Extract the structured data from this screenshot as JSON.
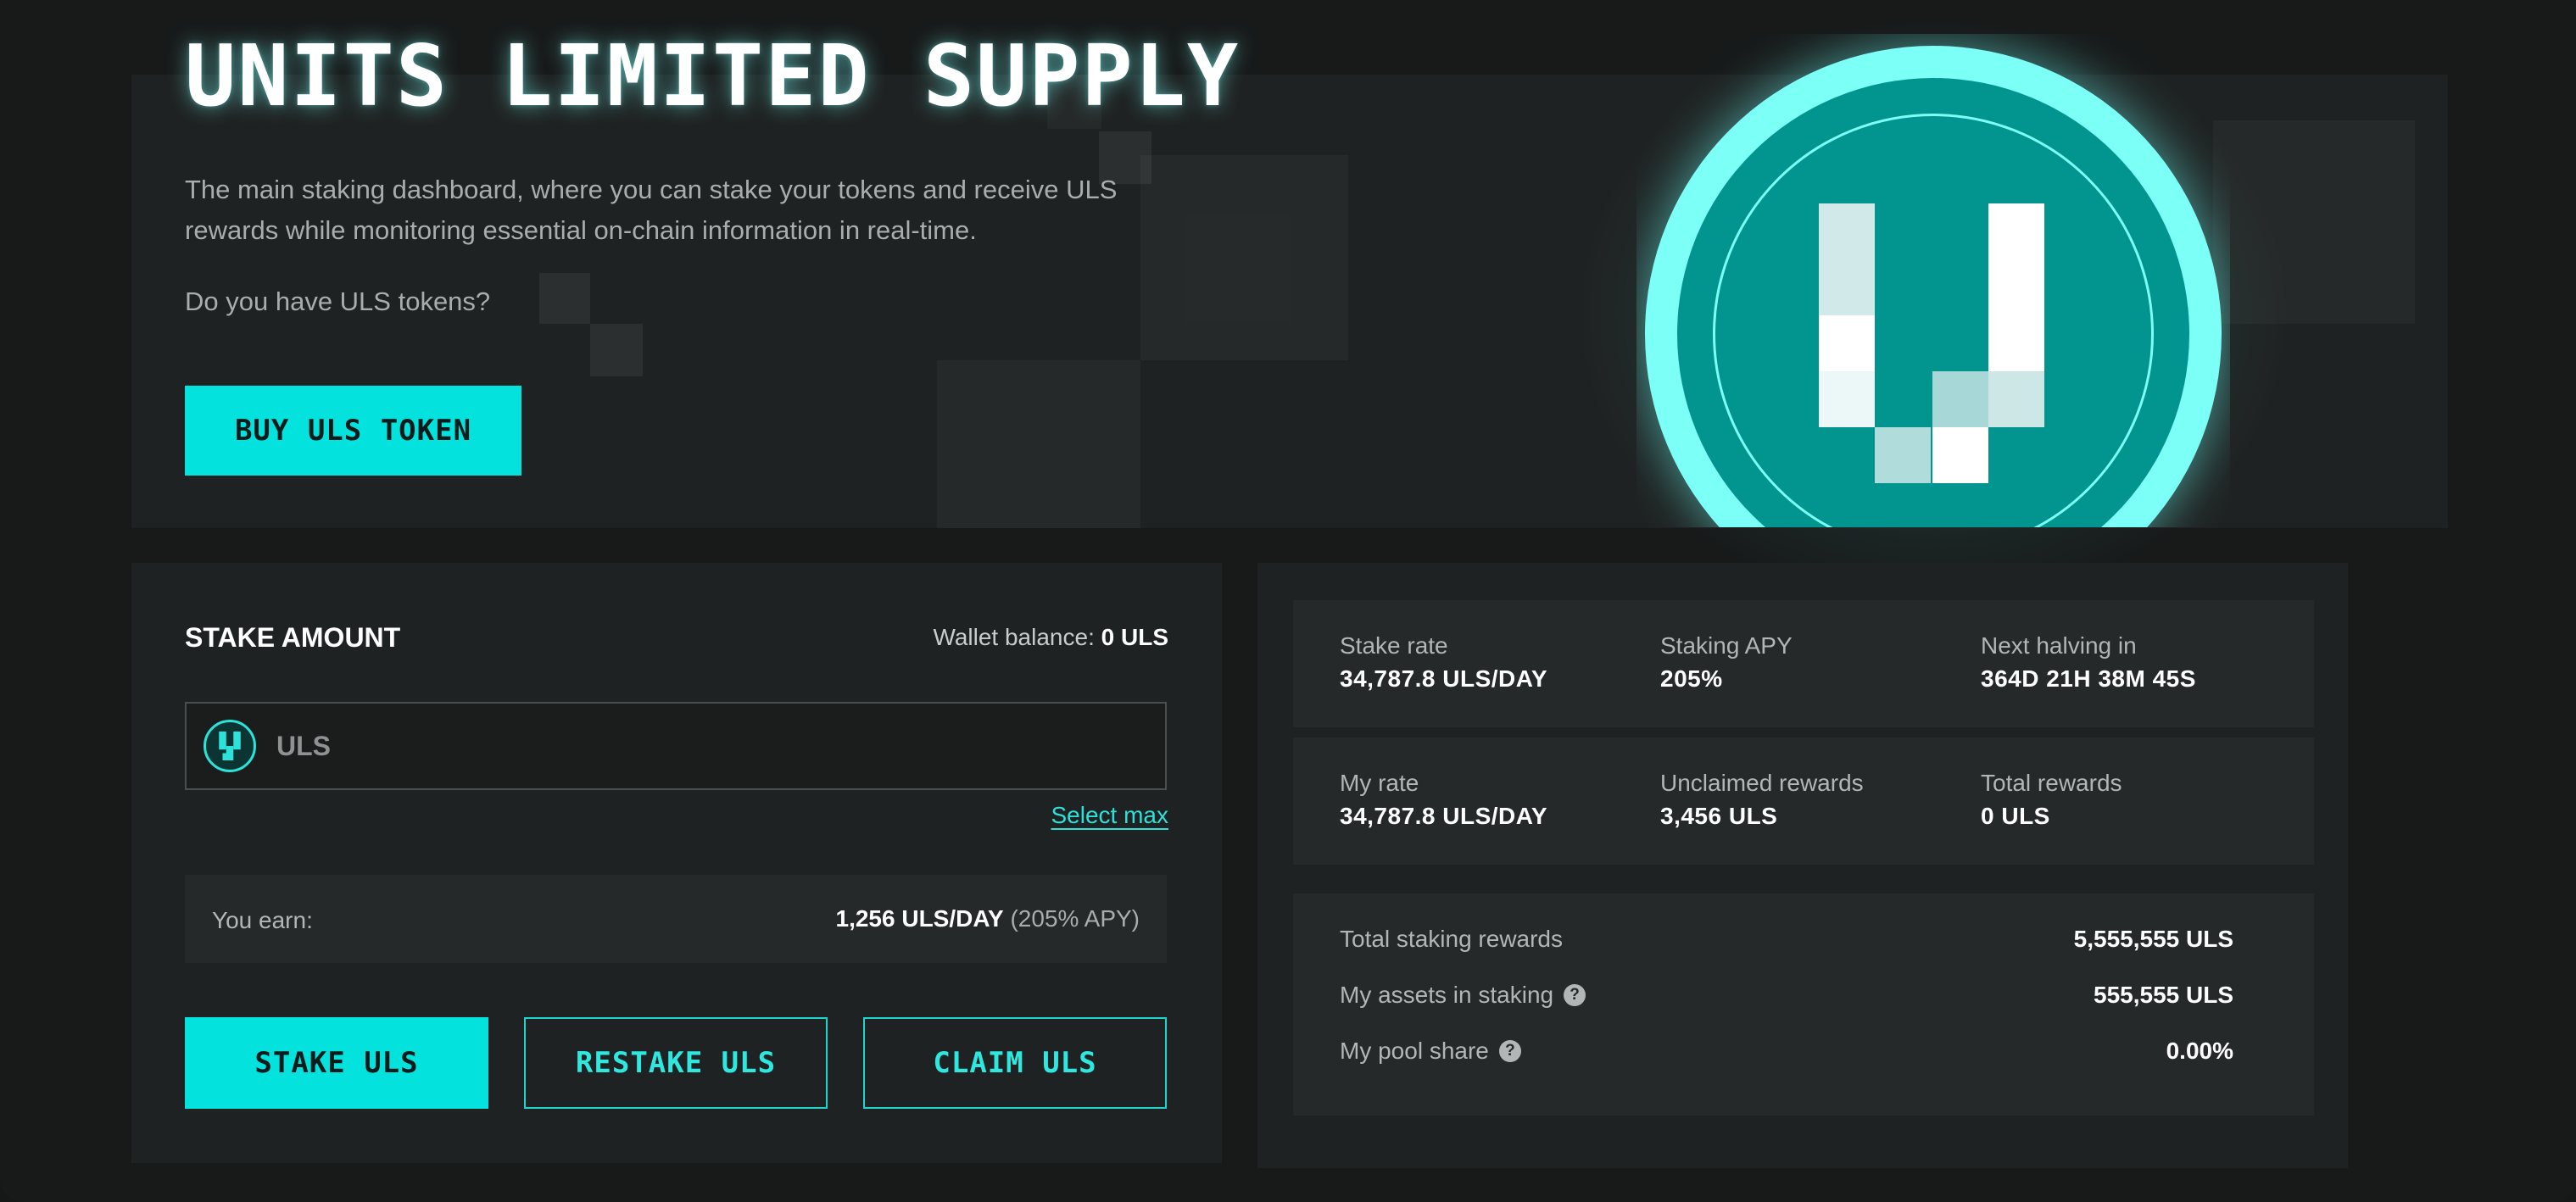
{
  "hero": {
    "title": "UNITS LIMITED SUPPLY",
    "description": "The main staking dashboard, where you can stake your tokens and receive ULS rewards while monitoring essential on-chain information in real-time.",
    "question": "Do you have ULS tokens?",
    "buy_button": "BUY ULS TOKEN"
  },
  "stake": {
    "title": "STAKE AMOUNT",
    "wallet_label": "Wallet balance:",
    "wallet_value": "0 ULS",
    "input_placeholder": "ULS",
    "select_max": "Select max",
    "earn_label": "You earn:",
    "earn_value": "1,256 ULS/DAY",
    "earn_apy": "(205% APY)",
    "buttons": {
      "stake": "STAKE ULS",
      "restake": "RESTAKE ULS",
      "claim": "CLAIM ULS"
    }
  },
  "stats": {
    "row1": [
      {
        "label": "Stake rate",
        "value": "34,787.8 ULS/DAY"
      },
      {
        "label": "Staking APY",
        "value": "205%"
      },
      {
        "label": "Next halving in",
        "value": "364D 21H 38M 45S"
      }
    ],
    "row2": [
      {
        "label": "My rate",
        "value": "34,787.8 ULS/DAY"
      },
      {
        "label": "Unclaimed rewards",
        "value": "3,456 ULS"
      },
      {
        "label": "Total rewards",
        "value": "0 ULS"
      }
    ],
    "totals": [
      {
        "label": "Total staking rewards",
        "value": "5,555,555 ULS"
      },
      {
        "label": "My assets in staking",
        "value": "555,555 ULS"
      },
      {
        "label": "My pool share",
        "value": "0.00%"
      }
    ],
    "help_glyph": "?"
  },
  "colors": {
    "accent": "#03e2dc",
    "logo_outer": "#7cfff6",
    "logo_inner": "#02958f",
    "panel": "#1f2222",
    "background": "#181a1a"
  },
  "icons": [
    "uls-logo-icon",
    "uls-token-icon",
    "help-icon"
  ]
}
